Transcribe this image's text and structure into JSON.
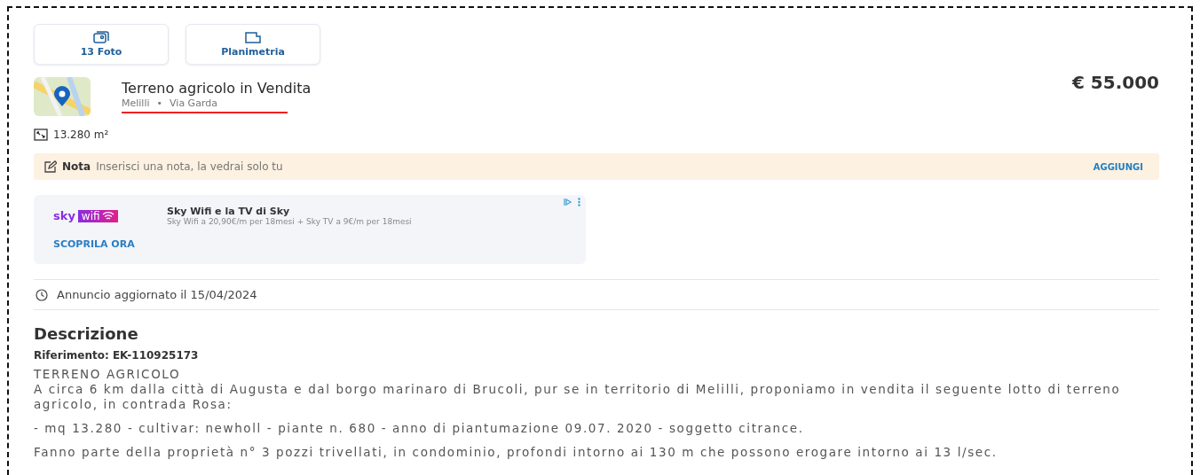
{
  "media_buttons": [
    {
      "kind": "photos",
      "label": "13 Foto"
    },
    {
      "kind": "plan",
      "label": "Planimetria"
    }
  ],
  "listing": {
    "title": "Terreno agricolo in Vendita",
    "city": "Melilli",
    "separator": "•",
    "street": "Via Garda",
    "price": "€ 55.000",
    "area": "13.280 m²"
  },
  "note": {
    "label": "Nota",
    "prompt": "Inserisci una nota, la vedrai solo tu",
    "action": "AGGIUNGI"
  },
  "ad": {
    "logo_brand": "sky",
    "logo_product": "wifi",
    "title": "Sky Wifi e la TV di Sky",
    "subtitle": "Sky Wifi a 20,90€/m per 18mesi + Sky TV a 9€/m per 18mesi",
    "cta": "SCOPRILA ORA"
  },
  "updated": "Annuncio aggiornato il 15/04/2024",
  "description": {
    "heading": "Descrizione",
    "reference": "Riferimento: EK-110925173",
    "paragraphs": [
      {
        "kind": "title",
        "text": "TERRENO AGRICOLO"
      },
      {
        "kind": "body",
        "text": "A circa 6 km dalla città di Augusta e dal borgo marinaro di Brucoli, pur se in territorio di Melilli, proponiamo in vendita il seguente lotto di terreno agricolo, in contrada Rosa:"
      },
      {
        "kind": "gap",
        "text": "- mq 13.280 - cultivar: newholl - piante n. 680 - anno di piantumazione 09.07. 2020 - soggetto citrance."
      },
      {
        "kind": "gap",
        "text": "Fanno parte della proprietà n° 3 pozzi trivellati, in condominio, profondi intorno ai 130 m che possono erogare intorno ai 13 l/sec."
      }
    ]
  }
}
